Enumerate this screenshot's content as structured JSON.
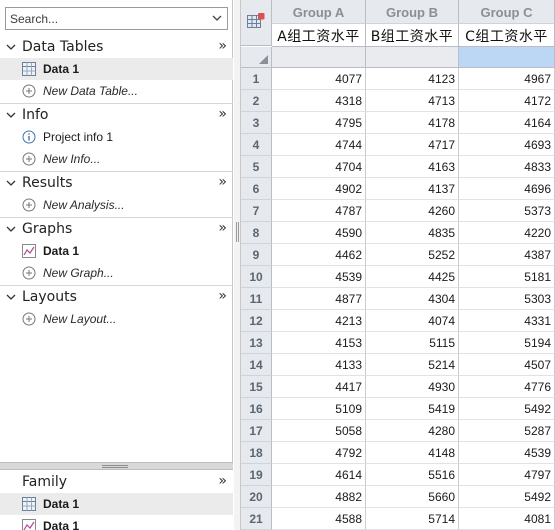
{
  "navigator": {
    "search_placeholder": "Search...",
    "sections": [
      {
        "title": "Data Tables",
        "more": "»",
        "items": [
          {
            "label": "Data 1",
            "icon": "data-table-icon",
            "bold": true,
            "selected": true
          },
          {
            "label": "New Data Table...",
            "icon": "plus-circle-icon",
            "italic": true
          }
        ]
      },
      {
        "title": "Info",
        "more": "»",
        "items": [
          {
            "label": "Project info 1",
            "icon": "info-icon"
          },
          {
            "label": "New Info...",
            "icon": "plus-circle-icon",
            "italic": true
          }
        ]
      },
      {
        "title": "Results",
        "more": "»",
        "items": [
          {
            "label": "New Analysis...",
            "icon": "plus-circle-icon",
            "italic": true
          }
        ]
      },
      {
        "title": "Graphs",
        "more": "»",
        "items": [
          {
            "label": "Data 1",
            "icon": "graph-icon",
            "bold": true
          },
          {
            "label": "New Graph...",
            "icon": "plus-circle-icon",
            "italic": true
          }
        ]
      },
      {
        "title": "Layouts",
        "more": "»",
        "items": [
          {
            "label": "New Layout...",
            "icon": "plus-circle-icon",
            "italic": true
          }
        ]
      }
    ],
    "family": {
      "title": "Family",
      "more": "»",
      "items": [
        {
          "label": "Data 1",
          "icon": "data-table-icon",
          "bold": true,
          "selected": true
        },
        {
          "label": "Data 1",
          "icon": "graph-icon",
          "bold": true
        }
      ]
    }
  },
  "sheet": {
    "columns": [
      {
        "group": "Group A",
        "title": "A组工资水平"
      },
      {
        "group": "Group B",
        "title": "B组工资水平"
      },
      {
        "group": "Group C",
        "title": "C组工资水平"
      }
    ],
    "rows": [
      {
        "n": "1",
        "values": [
          "4077",
          "4123",
          "4967"
        ]
      },
      {
        "n": "2",
        "values": [
          "4318",
          "4713",
          "4172"
        ]
      },
      {
        "n": "3",
        "values": [
          "4795",
          "4178",
          "4164"
        ]
      },
      {
        "n": "4",
        "values": [
          "4744",
          "4717",
          "4693"
        ]
      },
      {
        "n": "5",
        "values": [
          "4704",
          "4163",
          "4833"
        ]
      },
      {
        "n": "6",
        "values": [
          "4902",
          "4137",
          "4696"
        ]
      },
      {
        "n": "7",
        "values": [
          "4787",
          "4260",
          "5373"
        ]
      },
      {
        "n": "8",
        "values": [
          "4590",
          "4835",
          "4220"
        ]
      },
      {
        "n": "9",
        "values": [
          "4462",
          "5252",
          "4387"
        ]
      },
      {
        "n": "10",
        "values": [
          "4539",
          "4425",
          "5181"
        ]
      },
      {
        "n": "11",
        "values": [
          "4877",
          "4304",
          "5303"
        ]
      },
      {
        "n": "12",
        "values": [
          "4213",
          "4074",
          "4331"
        ]
      },
      {
        "n": "13",
        "values": [
          "4153",
          "5115",
          "5194"
        ]
      },
      {
        "n": "14",
        "values": [
          "4133",
          "5214",
          "4507"
        ]
      },
      {
        "n": "15",
        "values": [
          "4417",
          "4930",
          "4776"
        ]
      },
      {
        "n": "16",
        "values": [
          "5109",
          "5419",
          "5492"
        ]
      },
      {
        "n": "17",
        "values": [
          "5058",
          "4280",
          "5287"
        ]
      },
      {
        "n": "18",
        "values": [
          "4792",
          "4148",
          "4539"
        ]
      },
      {
        "n": "19",
        "values": [
          "4614",
          "5516",
          "4797"
        ]
      },
      {
        "n": "20",
        "values": [
          "4882",
          "5660",
          "5492"
        ]
      },
      {
        "n": "21",
        "values": [
          "4588",
          "5714",
          "4081"
        ]
      }
    ]
  },
  "colors": {
    "header_bg": "#e6e9ee",
    "selected_cell": "#bcd7f4",
    "row_number": "#5a6673",
    "group_header_text": "#8a8f96"
  }
}
